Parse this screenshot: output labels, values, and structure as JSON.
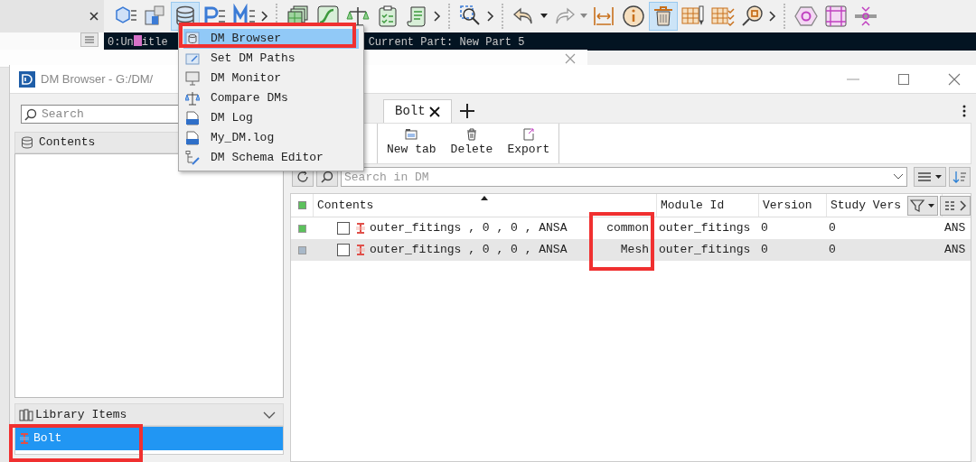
{
  "toolbar": {
    "groups": [
      [
        {
          "selected": false
        },
        {
          "selected": false
        },
        {
          "selected": true
        },
        {
          "selected": false
        },
        {
          "selected": false
        }
      ],
      [
        {
          "selected": false
        },
        {
          "selected": false
        },
        {
          "selected": false
        },
        {
          "selected": false
        },
        {
          "selected": false
        }
      ],
      [
        {
          "selected": false
        }
      ],
      [
        {
          "selected": false
        },
        {
          "selected": false
        },
        {
          "selected": false
        },
        {
          "selected": false
        },
        {
          "selected": true
        },
        {
          "selected": false
        },
        {
          "selected": false
        },
        {
          "selected": false
        }
      ],
      [
        {
          "selected": false
        },
        {
          "selected": false
        },
        {
          "selected": false
        }
      ]
    ]
  },
  "console": {
    "segments": [
      "0:Un",
      "itle"
    ],
    "current_part": "Current Part: New Part 5"
  },
  "window": {
    "title": "DM Browser - G:/DM/"
  },
  "left_panel": {
    "search": {
      "placeholder": "Search"
    },
    "contents_header": "Contents",
    "library_header": "Library Items",
    "library_items": [
      {
        "label": "Bolt",
        "selected": true
      }
    ]
  },
  "tabs": [
    {
      "label": "Bolt",
      "selected": true
    }
  ],
  "actions": [
    "New tab",
    "Delete",
    "Export"
  ],
  "dm_search": {
    "placeholder": "Search in DM"
  },
  "table": {
    "columns": [
      "Contents",
      "Module Id",
      "Version",
      "Study Vers"
    ],
    "rows": [
      {
        "color": "#5cc15c",
        "checked": false,
        "name": "outer_fitings , 0 , 0 , ANSA",
        "variant": "common",
        "module_id": "outer_fitings",
        "version": "0",
        "study_version": "0",
        "column_6": "ANS",
        "selected": false
      },
      {
        "color": "#a8b8c8",
        "checked": false,
        "name": "outer_fitings , 0 , 0 , ANSA",
        "variant": "Mesh",
        "module_id": "outer_fitings",
        "version": "0",
        "study_version": "0",
        "column_6": "ANS",
        "selected": true
      }
    ]
  },
  "dm_menu": {
    "items": [
      {
        "label": "DM Browser",
        "selected": true
      },
      {
        "label": "Set DM Paths",
        "selected": false
      },
      {
        "label": "DM Monitor",
        "selected": false
      },
      {
        "label": "Compare DMs",
        "selected": false
      },
      {
        "label": "DM Log",
        "selected": false
      },
      {
        "label": "My_DM.log",
        "selected": false
      },
      {
        "label": "DM Schema Editor",
        "selected": false
      }
    ]
  }
}
